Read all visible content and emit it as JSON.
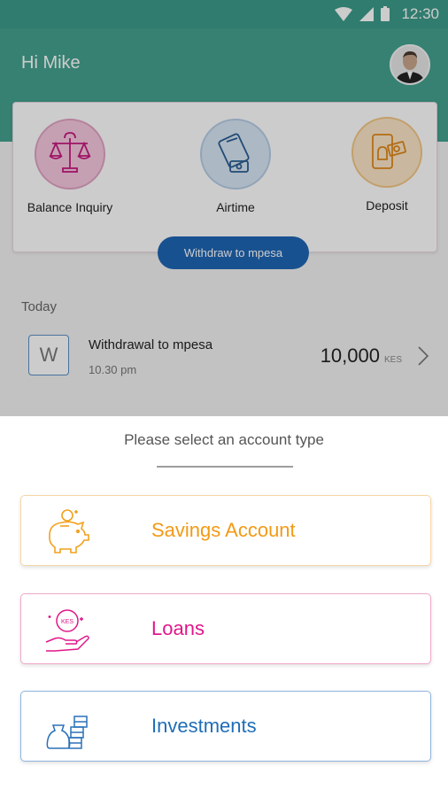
{
  "status_bar": {
    "time": "12:30"
  },
  "header": {
    "greeting": "Hi Mike"
  },
  "actions": [
    {
      "label": "Balance Inquiry",
      "icon": "balance-scale-icon"
    },
    {
      "label": "Airtime",
      "icon": "phone-airtime-icon"
    },
    {
      "label": "Deposit",
      "icon": "deposit-phone-cash-icon"
    }
  ],
  "withdraw_button": "Withdraw to mpesa",
  "transactions": {
    "section_label": "Today",
    "items": [
      {
        "initial": "W",
        "title": "Withdrawal to mpesa",
        "time": "10.30 pm",
        "amount": "10,000",
        "currency": "KES"
      }
    ]
  },
  "sheet": {
    "title": "Please select an account type",
    "accounts": [
      {
        "label": "Savings Account",
        "icon": "piggy-bank-icon",
        "color": "#f29a16"
      },
      {
        "label": "Loans",
        "icon": "hand-coin-icon",
        "color": "#e0178a"
      },
      {
        "label": "Investments",
        "icon": "money-bag-icon",
        "color": "#1f6db8"
      }
    ],
    "loan_coin_text": "KES"
  },
  "colors": {
    "header": "#44a28f",
    "button": "#1e66b4"
  }
}
